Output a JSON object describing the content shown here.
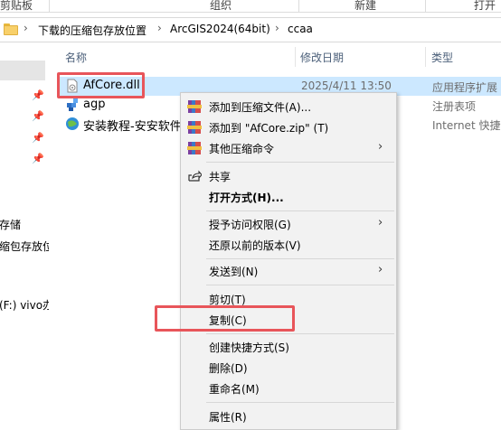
{
  "ribbon": {
    "clipboard_label": "剪贴板",
    "organize_label": "组织",
    "new_label": "新建",
    "open_label": "打开"
  },
  "address": {
    "crumbs": [
      "下载的压缩包存放位置",
      "ArcGIS2024(64bit)",
      "ccaa"
    ]
  },
  "nav": {
    "items": [
      "存储",
      "缩包存放位",
      "(F:) vivo办"
    ]
  },
  "columns": {
    "name": "名称",
    "date": "修改日期",
    "type": "类型"
  },
  "files": [
    {
      "name": "AfCore.dll",
      "date": "2025/4/11 13:50",
      "type": "应用程序扩展",
      "icon": "dll-file-icon"
    },
    {
      "name": "agp",
      "date": "",
      "type": "注册表项",
      "icon": "registry-file-icon"
    },
    {
      "name": "安装教程-安安软件",
      "date": "",
      "type": "Internet 快捷方",
      "icon": "internet-shortcut-icon"
    }
  ],
  "context_menu": {
    "items": [
      {
        "label": "添加到压缩文件(A)...",
        "icon": "winrar-icon"
      },
      {
        "label": "添加到 \"AfCore.zip\" (T)",
        "icon": "winrar-icon"
      },
      {
        "label": "其他压缩命令",
        "icon": "winrar-icon"
      },
      {
        "label": "共享",
        "icon": "share-icon"
      },
      {
        "label": "打开方式(H)..."
      },
      {
        "label": "授予访问权限(G)"
      },
      {
        "label": "还原以前的版本(V)"
      },
      {
        "label": "发送到(N)"
      },
      {
        "label": "剪切(T)"
      },
      {
        "label": "复制(C)"
      },
      {
        "label": "创建快捷方式(S)"
      },
      {
        "label": "删除(D)"
      },
      {
        "label": "重命名(M)"
      },
      {
        "label": "属性(R)"
      }
    ]
  },
  "colors": {
    "selection": "#cce8ff",
    "highlight_box": "#e8555a",
    "menu_bg": "#f2f2f2"
  }
}
